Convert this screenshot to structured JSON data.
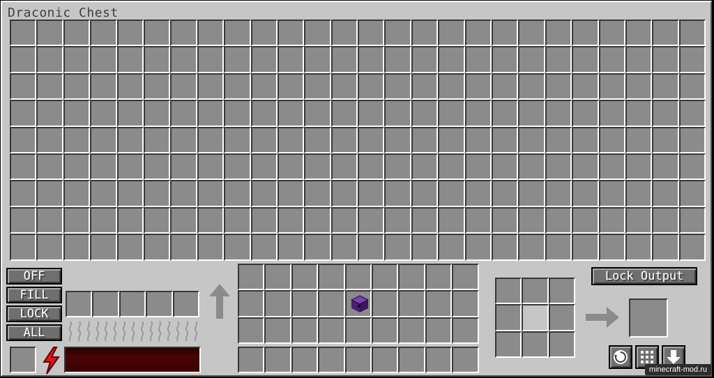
{
  "window": {
    "title": "Draconic Chest"
  },
  "main_storage": {
    "rows": 9,
    "cols": 26
  },
  "control_buttons": {
    "off": "OFF",
    "fill": "FILL",
    "lock": "LOCK",
    "all": "ALL"
  },
  "furnace": {
    "upgrade_slots": 5,
    "heat_indicators": 15,
    "energy_fraction": 0.0
  },
  "crafting_area": {
    "rows": 3,
    "cols": 9,
    "item_slot_index": 13,
    "item_icon": "purple-chest-icon"
  },
  "hotbar": {
    "slots": 9
  },
  "crafting_matrix": {
    "rows": 3,
    "cols": 3,
    "highlight_index": 4
  },
  "crafting_controls": {
    "lock_output": "Lock Output"
  },
  "icons": {
    "rotate": "rotate-icon",
    "balance": "balance-grid-icon",
    "dump": "arrow-down-icon"
  },
  "watermark": "minecraft-mod.ru",
  "colors": {
    "panel": "#c6c6c6",
    "slot": "#8b8b8b",
    "button": "#6f6f6f",
    "energy": "#c41e1e",
    "chest": "#5a2a8a"
  }
}
